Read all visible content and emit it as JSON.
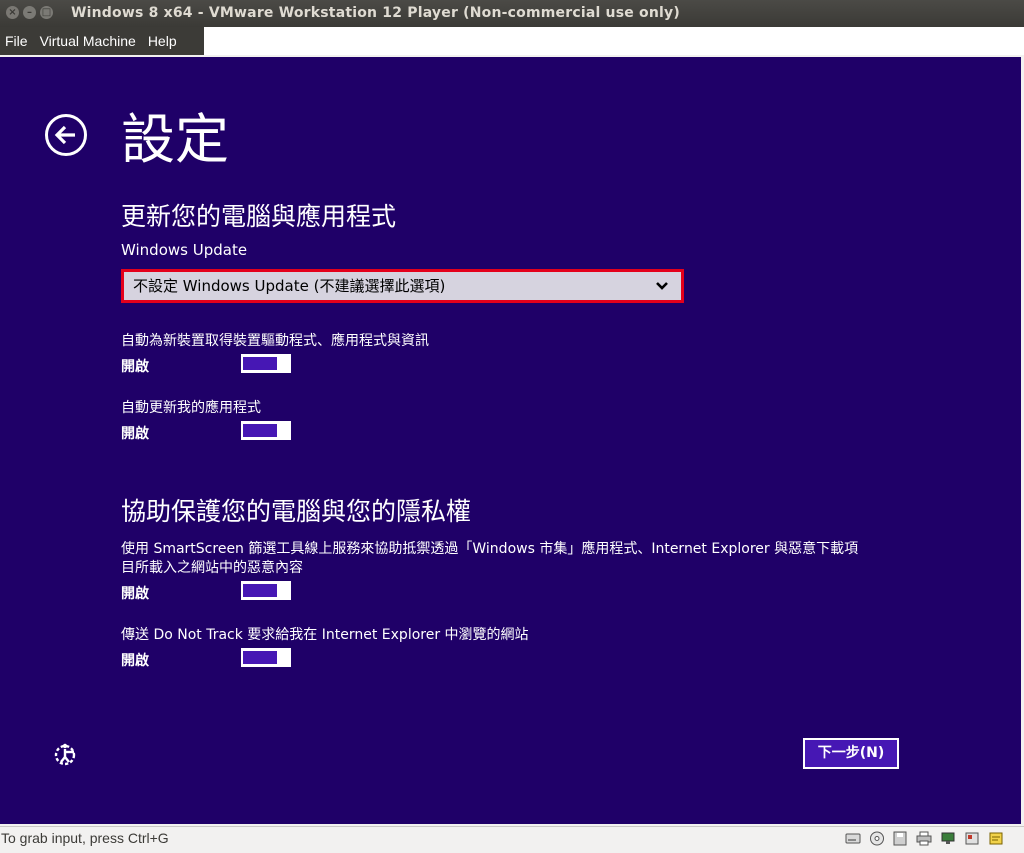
{
  "window": {
    "title": "Windows 8 x64 - VMware Workstation 12 Player (Non-commercial use only)",
    "close_glyph": "×",
    "minimize_glyph": "–",
    "maximize_glyph": "□"
  },
  "menu": {
    "items": [
      "File",
      "Virtual Machine",
      "Help"
    ]
  },
  "page": {
    "title": "設定",
    "back_icon": "back-arrow-circle-icon"
  },
  "section1": {
    "title": "更新您的電腦與應用程式",
    "wu_label": "Windows Update",
    "dropdown_value": "不設定 Windows Update (不建議選擇此選項)",
    "setting1_label": "自動為新裝置取得裝置驅動程式、應用程式與資訊",
    "setting1_state": "開啟",
    "setting2_label": "自動更新我的應用程式",
    "setting2_state": "開啟"
  },
  "section2": {
    "title": "協助保護您的電腦與您的隱私權",
    "setting3_label_line1": "使用 SmartScreen 篩選工具線上服務來協助抵禦透過「Windows 市集」應用程式、Internet Explorer 與惡意下載項",
    "setting3_label_line2": "目所載入之網站中的惡意內容",
    "setting3_state": "開啟",
    "setting4_label": "傳送 Do Not Track 要求給我在 Internet Explorer 中瀏覽的網站",
    "setting4_state": "開啟"
  },
  "footer": {
    "next_button": "下一步(N)",
    "ease_icon": "ease-of-access-icon"
  },
  "statusbar": {
    "text": "To grab input, press Ctrl+G",
    "icons": [
      "hard-disk-icon",
      "cd-icon",
      "floppy-icon",
      "printer-icon",
      "network-icon",
      "sound-icon",
      "message-icon"
    ]
  },
  "colors": {
    "guest_background": "#1f0068",
    "toggle_fill": "#4617b4",
    "dropdown_highlight": "#e4001b"
  }
}
